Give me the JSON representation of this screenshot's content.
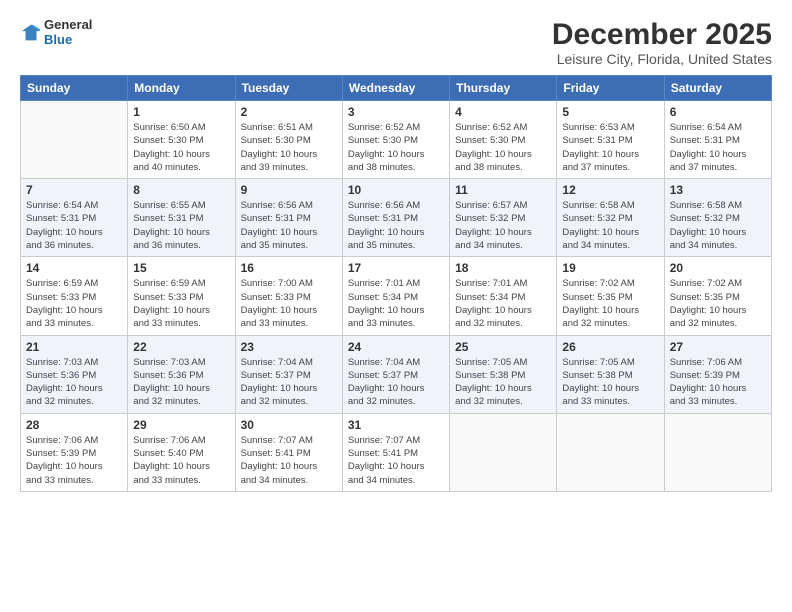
{
  "header": {
    "logo_general": "General",
    "logo_blue": "Blue",
    "month_title": "December 2025",
    "location": "Leisure City, Florida, United States"
  },
  "weekdays": [
    "Sunday",
    "Monday",
    "Tuesday",
    "Wednesday",
    "Thursday",
    "Friday",
    "Saturday"
  ],
  "weeks": [
    [
      {
        "day": "",
        "info": ""
      },
      {
        "day": "1",
        "info": "Sunrise: 6:50 AM\nSunset: 5:30 PM\nDaylight: 10 hours\nand 40 minutes."
      },
      {
        "day": "2",
        "info": "Sunrise: 6:51 AM\nSunset: 5:30 PM\nDaylight: 10 hours\nand 39 minutes."
      },
      {
        "day": "3",
        "info": "Sunrise: 6:52 AM\nSunset: 5:30 PM\nDaylight: 10 hours\nand 38 minutes."
      },
      {
        "day": "4",
        "info": "Sunrise: 6:52 AM\nSunset: 5:30 PM\nDaylight: 10 hours\nand 38 minutes."
      },
      {
        "day": "5",
        "info": "Sunrise: 6:53 AM\nSunset: 5:31 PM\nDaylight: 10 hours\nand 37 minutes."
      },
      {
        "day": "6",
        "info": "Sunrise: 6:54 AM\nSunset: 5:31 PM\nDaylight: 10 hours\nand 37 minutes."
      }
    ],
    [
      {
        "day": "7",
        "info": "Sunrise: 6:54 AM\nSunset: 5:31 PM\nDaylight: 10 hours\nand 36 minutes."
      },
      {
        "day": "8",
        "info": "Sunrise: 6:55 AM\nSunset: 5:31 PM\nDaylight: 10 hours\nand 36 minutes."
      },
      {
        "day": "9",
        "info": "Sunrise: 6:56 AM\nSunset: 5:31 PM\nDaylight: 10 hours\nand 35 minutes."
      },
      {
        "day": "10",
        "info": "Sunrise: 6:56 AM\nSunset: 5:31 PM\nDaylight: 10 hours\nand 35 minutes."
      },
      {
        "day": "11",
        "info": "Sunrise: 6:57 AM\nSunset: 5:32 PM\nDaylight: 10 hours\nand 34 minutes."
      },
      {
        "day": "12",
        "info": "Sunrise: 6:58 AM\nSunset: 5:32 PM\nDaylight: 10 hours\nand 34 minutes."
      },
      {
        "day": "13",
        "info": "Sunrise: 6:58 AM\nSunset: 5:32 PM\nDaylight: 10 hours\nand 34 minutes."
      }
    ],
    [
      {
        "day": "14",
        "info": "Sunrise: 6:59 AM\nSunset: 5:33 PM\nDaylight: 10 hours\nand 33 minutes."
      },
      {
        "day": "15",
        "info": "Sunrise: 6:59 AM\nSunset: 5:33 PM\nDaylight: 10 hours\nand 33 minutes."
      },
      {
        "day": "16",
        "info": "Sunrise: 7:00 AM\nSunset: 5:33 PM\nDaylight: 10 hours\nand 33 minutes."
      },
      {
        "day": "17",
        "info": "Sunrise: 7:01 AM\nSunset: 5:34 PM\nDaylight: 10 hours\nand 33 minutes."
      },
      {
        "day": "18",
        "info": "Sunrise: 7:01 AM\nSunset: 5:34 PM\nDaylight: 10 hours\nand 32 minutes."
      },
      {
        "day": "19",
        "info": "Sunrise: 7:02 AM\nSunset: 5:35 PM\nDaylight: 10 hours\nand 32 minutes."
      },
      {
        "day": "20",
        "info": "Sunrise: 7:02 AM\nSunset: 5:35 PM\nDaylight: 10 hours\nand 32 minutes."
      }
    ],
    [
      {
        "day": "21",
        "info": "Sunrise: 7:03 AM\nSunset: 5:36 PM\nDaylight: 10 hours\nand 32 minutes."
      },
      {
        "day": "22",
        "info": "Sunrise: 7:03 AM\nSunset: 5:36 PM\nDaylight: 10 hours\nand 32 minutes."
      },
      {
        "day": "23",
        "info": "Sunrise: 7:04 AM\nSunset: 5:37 PM\nDaylight: 10 hours\nand 32 minutes."
      },
      {
        "day": "24",
        "info": "Sunrise: 7:04 AM\nSunset: 5:37 PM\nDaylight: 10 hours\nand 32 minutes."
      },
      {
        "day": "25",
        "info": "Sunrise: 7:05 AM\nSunset: 5:38 PM\nDaylight: 10 hours\nand 32 minutes."
      },
      {
        "day": "26",
        "info": "Sunrise: 7:05 AM\nSunset: 5:38 PM\nDaylight: 10 hours\nand 33 minutes."
      },
      {
        "day": "27",
        "info": "Sunrise: 7:06 AM\nSunset: 5:39 PM\nDaylight: 10 hours\nand 33 minutes."
      }
    ],
    [
      {
        "day": "28",
        "info": "Sunrise: 7:06 AM\nSunset: 5:39 PM\nDaylight: 10 hours\nand 33 minutes."
      },
      {
        "day": "29",
        "info": "Sunrise: 7:06 AM\nSunset: 5:40 PM\nDaylight: 10 hours\nand 33 minutes."
      },
      {
        "day": "30",
        "info": "Sunrise: 7:07 AM\nSunset: 5:41 PM\nDaylight: 10 hours\nand 34 minutes."
      },
      {
        "day": "31",
        "info": "Sunrise: 7:07 AM\nSunset: 5:41 PM\nDaylight: 10 hours\nand 34 minutes."
      },
      {
        "day": "",
        "info": ""
      },
      {
        "day": "",
        "info": ""
      },
      {
        "day": "",
        "info": ""
      }
    ]
  ]
}
